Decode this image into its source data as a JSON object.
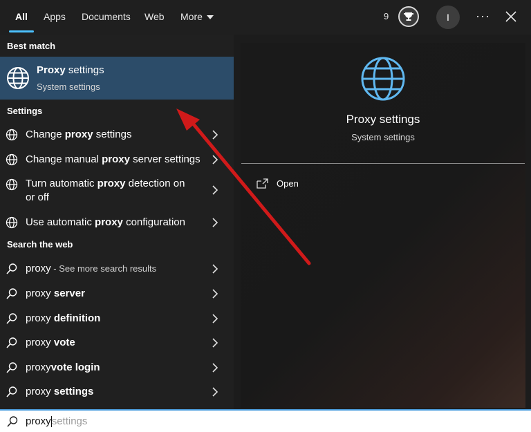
{
  "tabs": [
    {
      "label": "All",
      "active": true
    },
    {
      "label": "Apps"
    },
    {
      "label": "Documents"
    },
    {
      "label": "Web"
    },
    {
      "label": "More"
    }
  ],
  "header": {
    "points": "9",
    "avatar_initial": "I",
    "ellipsis": "···"
  },
  "best_match": {
    "header": "Best match",
    "title_bold": "Proxy",
    "title_rest": " settings",
    "subtitle": "System settings",
    "icon": "globe-icon"
  },
  "settings": {
    "header": "Settings",
    "items": [
      {
        "pre": "Change ",
        "bold": "proxy",
        "post": " settings"
      },
      {
        "pre": "Change manual ",
        "bold": "proxy",
        "post": " server settings"
      },
      {
        "pre": "Turn automatic ",
        "bold": "proxy",
        "post": " detection on or off"
      },
      {
        "pre": "Use automatic ",
        "bold": "proxy",
        "post": " configuration"
      }
    ]
  },
  "web": {
    "header": "Search the web",
    "items": [
      {
        "pre": "proxy",
        "bold": "",
        "muted": " - See more search results"
      },
      {
        "pre": "proxy ",
        "bold": "server"
      },
      {
        "pre": "proxy ",
        "bold": "definition"
      },
      {
        "pre": "proxy ",
        "bold": "vote"
      },
      {
        "pre": "proxy",
        "bold": "vote login"
      },
      {
        "pre": "proxy ",
        "bold": "settings"
      }
    ]
  },
  "preview": {
    "title": "Proxy settings",
    "subtitle": "System settings",
    "open_label": "Open"
  },
  "search": {
    "typed": "proxy",
    "hint": "settings",
    "icon": "search-icon"
  },
  "colors": {
    "accent": "#4cc2ff",
    "selected_row": "#2c4c69",
    "annotation_arrow": "#d01a1a"
  }
}
